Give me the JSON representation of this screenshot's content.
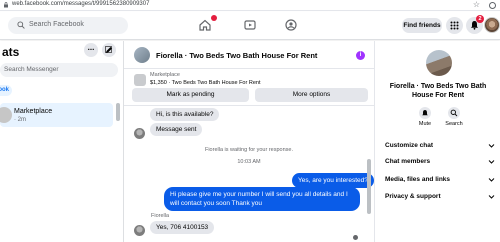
{
  "browser": {
    "url": "web.facebook.com/messages/t/9991562380909307"
  },
  "topbar": {
    "search_placeholder": "Search Facebook",
    "find_friends": "Find friends",
    "notification_count": "2"
  },
  "left": {
    "title": "ats",
    "more": "...",
    "search_placeholder": "Search Messenger",
    "filter_label": "ook",
    "conversation": {
      "name": "Marketplace",
      "time": "· 2m"
    }
  },
  "conversation": {
    "title": "Fiorella · Two Beds Two Bath House For Rent",
    "info_glyph": "i",
    "product_label": "Marketplace",
    "product_desc": "$1,350 · Two Beds Two Bath House For Rent",
    "mark_pending": "Mark as pending",
    "more_options": "More options",
    "messages": {
      "in_1": "Hi, is this available?",
      "in_2": "Message sent",
      "system": "Fiorella is waiting for your response.",
      "time": "10:03 AM",
      "out_1": "Yes, are you interested?",
      "out_2": "Hi please give me your number I will send you all details and I will contact you soon Thank you",
      "sender": "Fiorella",
      "in_3": "Yes, 706 4100153"
    }
  },
  "info_panel": {
    "name": "Fiorella · Two Beds Two Bath House For Rent",
    "mute": "Mute",
    "search": "Search",
    "sections": [
      "Customize chat",
      "Chat members",
      "Media, files and links",
      "Privacy & support"
    ]
  },
  "colors": {
    "brand_blue": "#1877f2",
    "outgoing_bubble": "#0a5ce8",
    "incoming_bubble": "#e4e6eb",
    "badge_red": "#e41e3f",
    "info_purple": "#a033ff"
  }
}
